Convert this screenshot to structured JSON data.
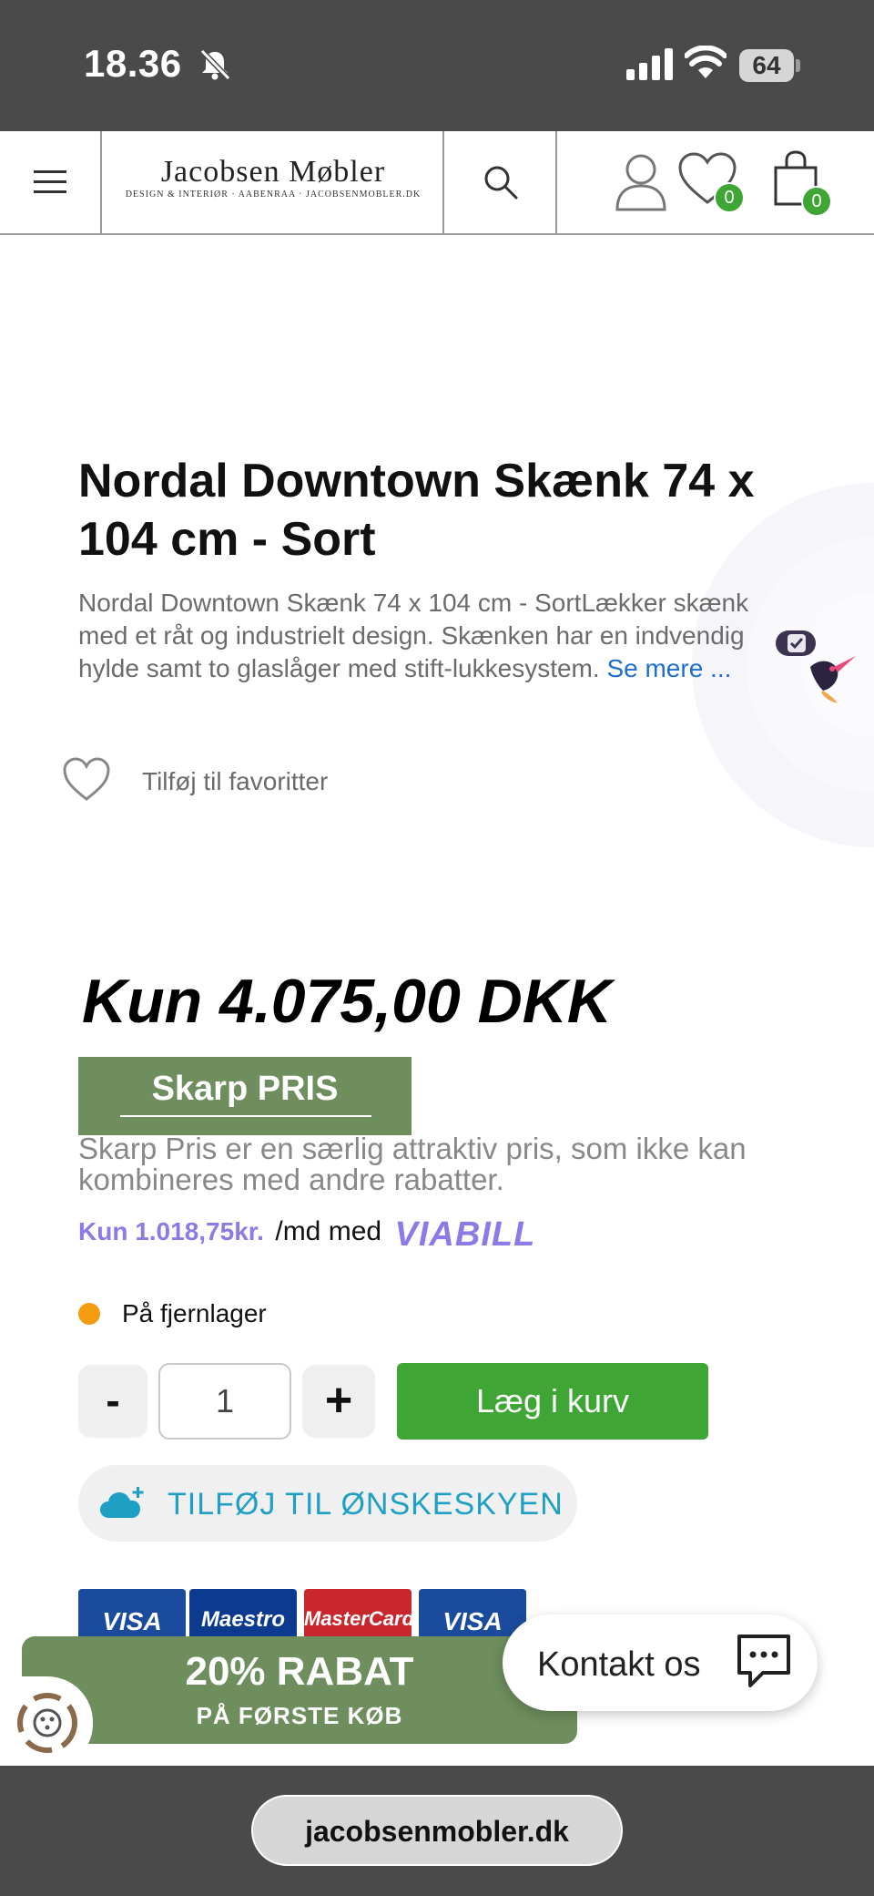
{
  "status_bar": {
    "time": "18.36",
    "battery": "64"
  },
  "header": {
    "logo_main": "Jacobsen Møbler",
    "logo_sub": "DESIGN & INTERIØR · AABENRAA · JACOBSENMOBLER.DK",
    "favorites_count": "0",
    "cart_count": "0"
  },
  "product": {
    "title": "Nordal Downtown Skænk 74 x 104 cm - Sort",
    "description": "Nordal Downtown Skænk 74 x 104 cm - SortLækker skænk med et råt og industrielt design. Skænken har en indvendig hylde samt to glaslåger med stift-lukkesystem.",
    "see_more": "Se mere ...",
    "favorite_label": "Tilføj til favoritter",
    "price": "Kun 4.075,00 DKK",
    "badge": "Skarp PRIS",
    "badge_description": "Skarp Pris er en særlig attraktiv pris, som ikke kan kombineres med andre rabatter.",
    "viabill_amount": "Kun 1.018,75kr.",
    "viabill_per": "/md med",
    "viabill_logo": "VIABILL",
    "stock_status": "På fjernlager",
    "stock_color": "#f39c12",
    "quantity": "1",
    "minus_label": "-",
    "plus_label": "+",
    "add_to_cart": "Læg i kurv",
    "wishcloud": "TILFØJ TIL ØNSKESKYEN"
  },
  "payment_cards": [
    "VISA",
    "Maestro",
    "MasterCard",
    "VISA"
  ],
  "promo": {
    "headline": "20% RABAT",
    "subline": "PÅ FØRSTE KØB"
  },
  "contact": {
    "label": "Kontakt os"
  },
  "browser": {
    "url": "jacobsenmobler.dk"
  },
  "colors": {
    "accent_green": "#3fa535",
    "badge_green": "#6e8e5e",
    "link_blue": "#1f6fd1",
    "viabill_purple": "#8b7be6",
    "wishcloud_blue": "#1e9fc4"
  }
}
